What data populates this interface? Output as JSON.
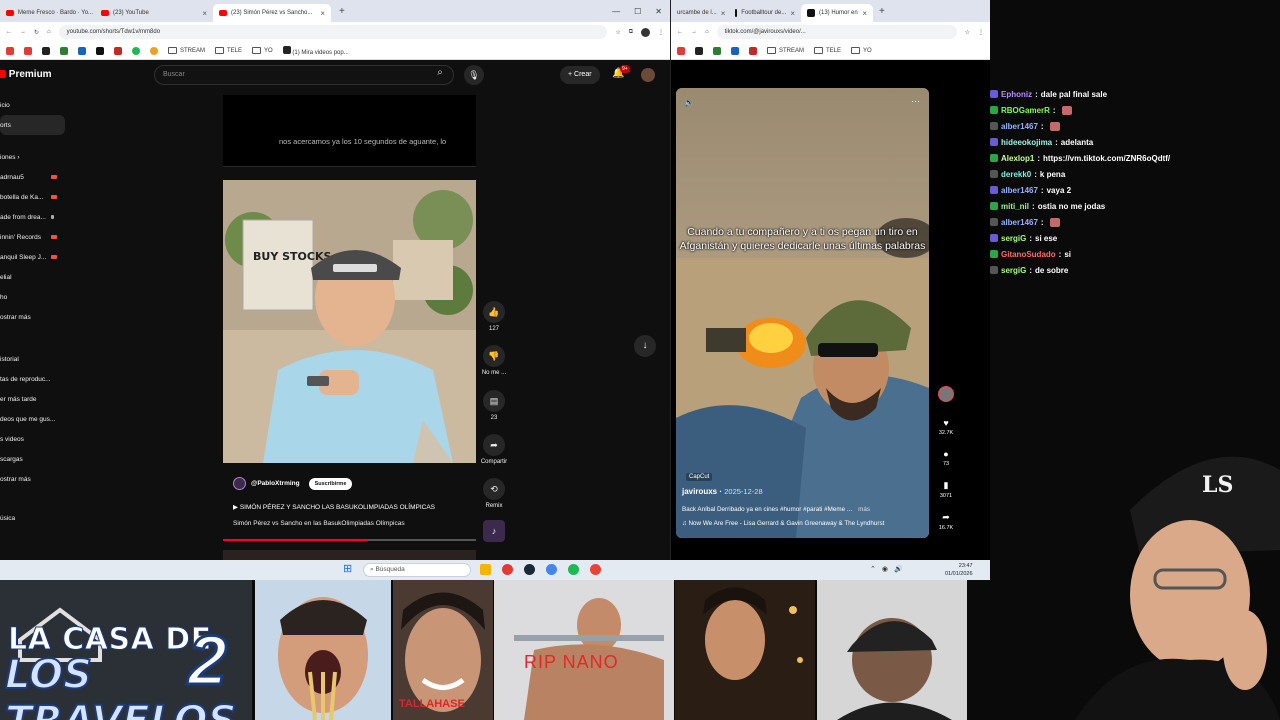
{
  "left_browser": {
    "tabs": [
      {
        "label": "Meme Fresco · Bardo · Yo..."
      },
      {
        "label": "(23) YouTube"
      },
      {
        "label": "(23) Simón Pérez vs Sancho..."
      }
    ],
    "url": "youtube.com/shorts/Tdw1v/mm8do",
    "bookmarks": [
      "STREAM",
      "TELE",
      "YO",
      "(1) Mira videos pop..."
    ],
    "yt": {
      "logo": "Premium",
      "search_placeholder": "Buscar",
      "create_label": "Crear",
      "notif_count": "9+"
    },
    "sidebar": [
      {
        "label": "icio"
      },
      {
        "label": "orts"
      },
      {
        "label": "iones ›"
      },
      {
        "label": "adrnau5"
      },
      {
        "label": "botella de Ka..."
      },
      {
        "label": "ade from drea..."
      },
      {
        "label": "innin' Records"
      },
      {
        "label": "anquil Sleep J..."
      },
      {
        "label": "elial"
      },
      {
        "label": "ho"
      },
      {
        "label": "ostrar más"
      },
      {
        "label": "istorial"
      },
      {
        "label": "tas de reproduc..."
      },
      {
        "label": "er más tarde"
      },
      {
        "label": "deos que me gus..."
      },
      {
        "label": "s videos"
      },
      {
        "label": "scargas"
      },
      {
        "label": "ostrar más"
      },
      {
        "label": "úsica"
      }
    ],
    "caption": "nos acercamos ya los 10 segundos de aguante, lo",
    "short": {
      "channel": "@PabloXtrming",
      "subscribe": "Suscribirme",
      "song": "SIMÓN PÉREZ Y SANCHO LAS BASUKOLIMPIADAS OLÍMPICAS",
      "description": "Simón Pérez vs Sancho en las BasukOlimpiadas Olímpicas",
      "progress": 0.57,
      "video_text": "BUY STOCKS"
    },
    "actions": {
      "like_count": "127",
      "dislike_label": "No me ...",
      "comments_count": "23",
      "share_label": "Compartir",
      "remix_label": "Remix"
    }
  },
  "right_browser": {
    "tabs": [
      {
        "label": "urcambe de l..."
      },
      {
        "label": "Footballtour de..."
      },
      {
        "label": "(13) Humor en"
      }
    ],
    "url": "tiktok.com/@javirouxs/video/...",
    "bookmarks": [
      "STREAM",
      "TELE",
      "YO"
    ],
    "tiktok": {
      "caption": "Cuando a tu compañero y a ti os pegan un tiro en Afganistán y quieres dedicarle unas últimas palabras",
      "watermark": "CapCut",
      "username": "javirouxs",
      "date": "2025-12-28",
      "description": "Back Aníbal Derribado ya en cines #humor #parati #Meme ...",
      "more": "más",
      "music": "Now We Are Free - Lisa Gerrard & Gavin Greenaway & The Lyndhurst",
      "likes": "32.7K",
      "comments": "73",
      "saves": "3071",
      "shares": "16.7K"
    }
  },
  "chat": [
    {
      "user": "Ephoniz",
      "color": "#b68cff",
      "msg": "dale pal final sale"
    },
    {
      "user": "RBOGamerR",
      "color": "#7cff4f",
      "msg": ""
    },
    {
      "user": "alber1467",
      "color": "#8fb4ff",
      "msg": ""
    },
    {
      "user": "hideeokojima",
      "color": "#9ff2e6",
      "msg": "adelanta"
    },
    {
      "user": "Alexlop1",
      "color": "#c9ff8c",
      "msg": "https://vm.tiktok.com/ZNR6oQdtf/"
    },
    {
      "user": "derekk0",
      "color": "#7ef0e0",
      "msg": "k pena"
    },
    {
      "user": "alber1467",
      "color": "#8fb4ff",
      "msg": "vaya 2"
    },
    {
      "user": "miti_nil",
      "color": "#9ef28c",
      "msg": "ostia no me jodas"
    },
    {
      "user": "alber1467",
      "color": "#8fb4ff",
      "msg": ""
    },
    {
      "user": "sergiG",
      "color": "#a4ff6e",
      "msg": "si ese"
    },
    {
      "user": "GitanoSudado",
      "color": "#ff6b6b",
      "msg": "si"
    },
    {
      "user": "sergiG",
      "color": "#a4ff6e",
      "msg": "de sobre"
    }
  ],
  "taskbar": {
    "search": "Búsqueda",
    "time": "23:47",
    "date": "01/01/2026"
  },
  "bottom": {
    "casa_title": "LA CASA DE",
    "casa_sub": "LOS TRAVELOS",
    "casa_num": "2",
    "tallahase": "TALLAHASE",
    "rip": "RIP NANO"
  },
  "colors": {
    "yt_red": "#ff0000",
    "tiktok_bg": "#000000",
    "taskbar": "#e4eaf2"
  }
}
